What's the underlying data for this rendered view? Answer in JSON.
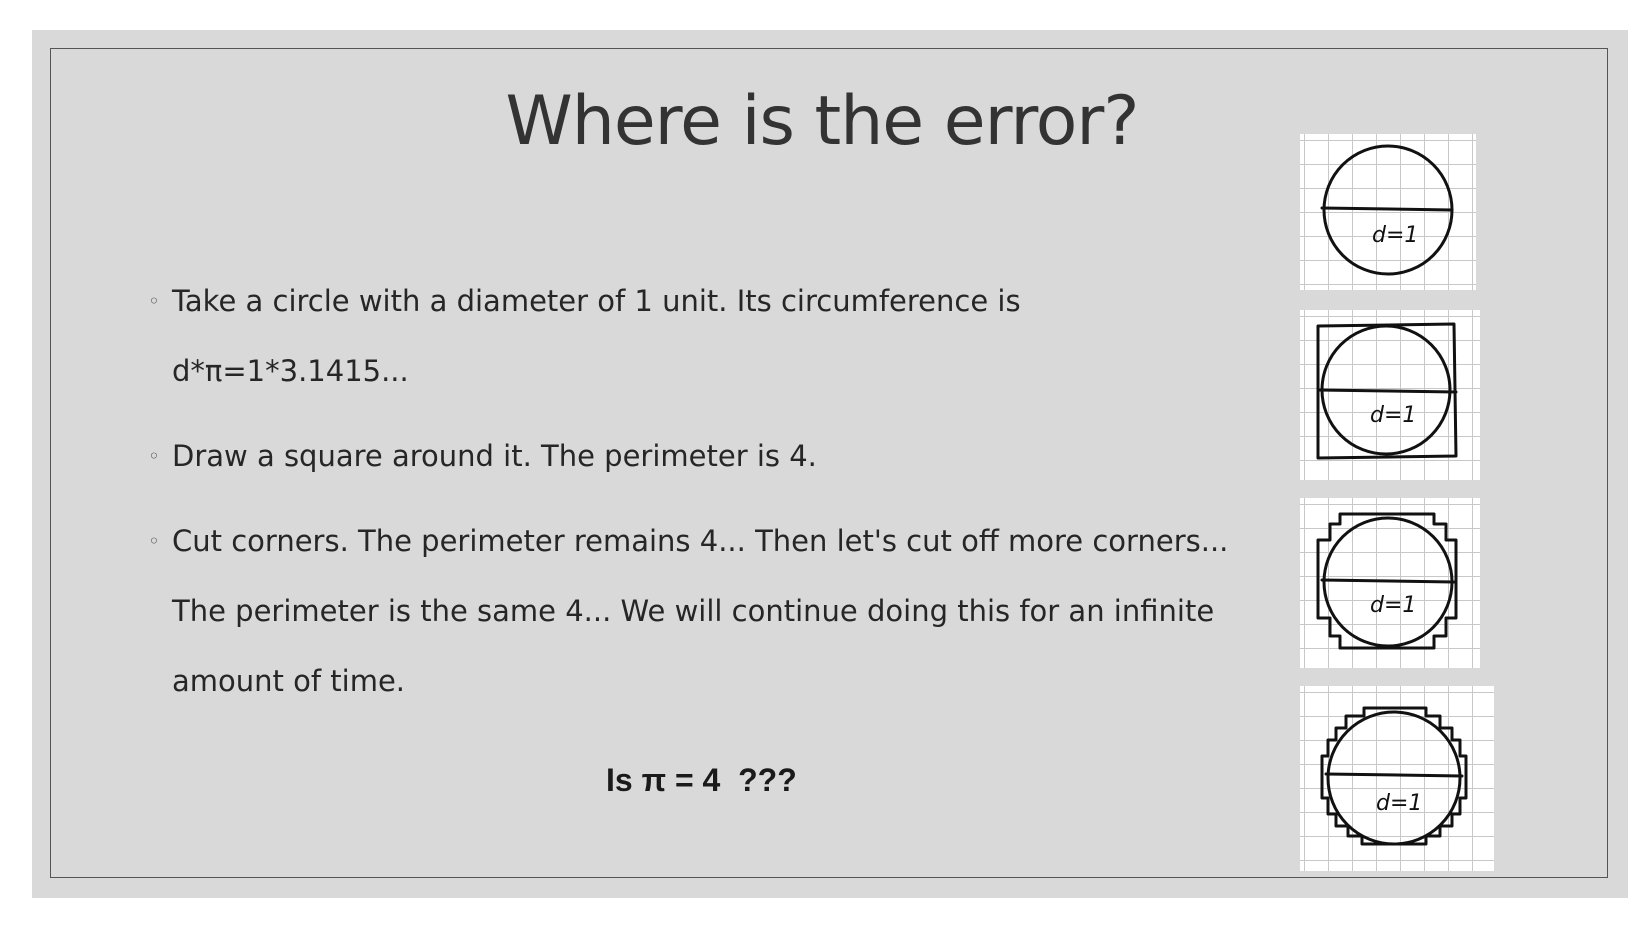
{
  "slide": {
    "title": "Where is the error?",
    "bullet_symbol": "◦",
    "bullets": [
      {
        "text": "Take a circle with a diameter of 1 unit. Its circumference is d*π=1*3.1415..."
      },
      {
        "text": "Draw a square around it. The perimeter is 4."
      },
      {
        "text": "Cut corners. The perimeter remains 4... Then let's cut off more corners... The perimeter is the same 4... We will continue doing this for an infinite amount of time."
      }
    ],
    "question": "Is π = 4  ???"
  },
  "sketches": [
    {
      "label": "d=1",
      "stage": "circle"
    },
    {
      "label": "d=1",
      "stage": "square"
    },
    {
      "label": "d=1",
      "stage": "cut corners"
    },
    {
      "label": "d=1",
      "stage": "more corners cut"
    }
  ]
}
